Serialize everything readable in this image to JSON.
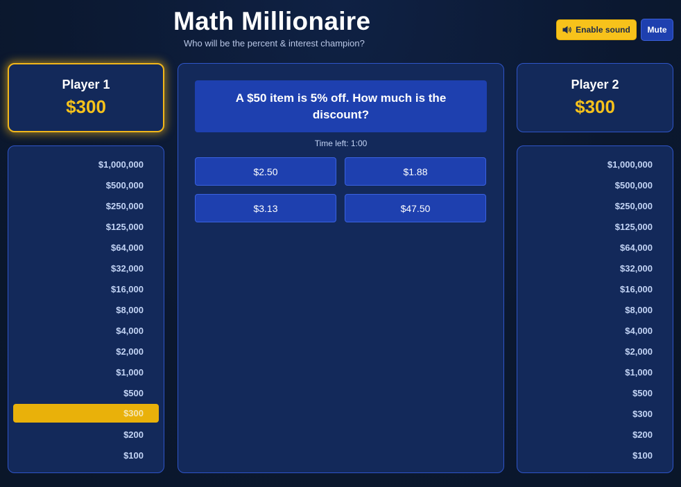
{
  "header": {
    "title": "Math Millionaire",
    "subtitle": "Who will be the percent & interest champion?",
    "enable_sound_label": "Enable sound",
    "mute_label": "Mute"
  },
  "players": [
    {
      "name": "Player 1",
      "score": "$300",
      "active": true
    },
    {
      "name": "Player 2",
      "score": "$300",
      "active": false
    }
  ],
  "ladder": {
    "levels": [
      "$1,000,000",
      "$500,000",
      "$250,000",
      "$125,000",
      "$64,000",
      "$32,000",
      "$16,000",
      "$8,000",
      "$4,000",
      "$2,000",
      "$1,000",
      "$500",
      "$300",
      "$200",
      "$100"
    ],
    "player1_current": "$300"
  },
  "question": {
    "text": "A $50 item is 5% off. How much is the discount?",
    "timer": "Time left: 1:00",
    "answers": [
      "$2.50",
      "$1.88",
      "$3.13",
      "$47.50"
    ]
  },
  "colors": {
    "accent_gold": "#f7c21b",
    "panel_blue": "#13295a",
    "button_blue": "#1e40af",
    "background": "#0b1830"
  },
  "icons": {
    "sound": "speaker-icon"
  }
}
